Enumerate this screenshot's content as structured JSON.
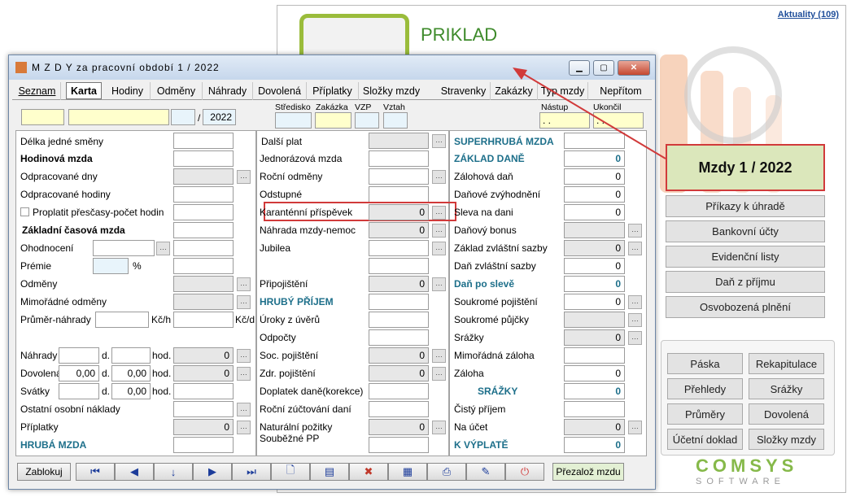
{
  "bg": {
    "news": "Aktuality (109)",
    "app_name": "PRIKLAD",
    "mzdy_button": "Mzdy  1 / 2022",
    "menu": [
      "Příkazy k úhradě",
      "Bankovní účty",
      "Evidenční listy",
      "Daň z příjmu",
      "Osvobozená plnění"
    ],
    "grid": [
      "Páska",
      "Rekapitulace",
      "Přehledy",
      "Srážky",
      "Průměry",
      "Dovolená",
      "Účetní doklad",
      "Složky mzdy"
    ],
    "brand1": "COMSYS",
    "brand2": "SOFTWARE"
  },
  "win": {
    "title": "M Z D Y  za pracovní období  1 / 2022",
    "btn_min": "▁",
    "btn_max": "▢",
    "btn_close": "✕",
    "tabs": [
      "Seznam",
      "Karta",
      "Hodiny",
      "Odměny",
      "Náhrady",
      "Dovolená",
      "Příplatky",
      "Složky mzdy",
      "Stravenky",
      "Zakázky",
      "Typ mzdy",
      "Nepřítom"
    ],
    "hdr": {
      "year": "2022",
      "slash": "/",
      "stredisko": "Středisko",
      "zakazka": "Zakázka",
      "vzp": "VZP",
      "vztah": "Vztah",
      "nastup": "Nástup",
      "ukoncil": "Ukončil",
      "nastup_val": ". .",
      "ukoncil_val": ". ."
    },
    "left": {
      "delka": "Délka jedné směny",
      "hodinova": "Hodinová mzda",
      "odpr_dny": "Odpracované dny",
      "odpr_hod": "Odpracované hodiny",
      "proplatit": "Proplatit přesčasy-počet hodin",
      "zakl": "Základní časová mzda",
      "ohodnoceni": "Ohodnocení",
      "premie": "Prémie",
      "pct": "%",
      "odmeny": "Odměny",
      "mimor": "Mimořádné odměny",
      "prumer": "Průměr-náhrady",
      "kch": "Kč/h",
      "kcd": "Kč/d",
      "nahrady": "Náhrady",
      "dovolena": "Dovolená",
      "svatky": "Svátky",
      "d": "d.",
      "hod": "hod.",
      "dov_d": "0,00",
      "dov_h": "0,00",
      "sv_h": "0,00",
      "nah_v": "0",
      "dov_v": "0",
      "ostatni": "Ostatní osobní náklady",
      "priplatky": "Příplatky",
      "pripl_v": "0",
      "hruba": "HRUBÁ MZDA"
    },
    "mid": {
      "dalsi": "Další plat",
      "jednoraz": "Jednorázová mzda",
      "rocni": "Roční odměny",
      "odstupne": "Odstupné",
      "karant": "Karanténní příspěvek",
      "karant_v": "0",
      "nahrada": "Náhrada mzdy-nemoc",
      "nahrada_v": "0",
      "jubilea": "Jubilea",
      "pripoj": "Připojištění",
      "pripoj_v": "0",
      "hruby": "HRUBÝ PŘÍJEM",
      "uroky": "Úroky z úvěrů",
      "odpocty": "Odpočty",
      "soc": "Soc. pojištění",
      "soc_v": "0",
      "zdr": "Zdr. pojištění",
      "zdr_v": "0",
      "doplatek": "Doplatek daně(korekce)",
      "rocni_zuct": "Roční zúčtování daní",
      "natur": "Naturální požitky",
      "natur_v": "0",
      "soubezne": "Souběžné PP"
    },
    "right": {
      "super": "SUPERHRUBÁ MZDA",
      "zaklad": "ZÁKLAD DANĚ",
      "zaklad_v": "0",
      "zaloh": "Zálohová daň",
      "zaloh_v": "0",
      "danzv": "Daňové zvýhodnění",
      "danzv_v": "0",
      "sleva": "Sleva na dani",
      "sleva_v": "0",
      "bonus": "Daňový bonus",
      "zakl_zvl": "Základ zvláštní sazby",
      "zakl_zvl_v": "0",
      "dan_zvl": "Daň zvláštní sazby",
      "dan_zvl_v": "0",
      "dan_po": "Daň po slevě",
      "dan_po_v": "0",
      "souk_poj": "Soukromé pojištění",
      "souk_poj_v": "0",
      "souk_puj": "Soukromé půjčky",
      "srazky": "Srážky",
      "srazky_v": "0",
      "mim_zal": "Mimořádná záloha",
      "zaloha": "Záloha",
      "zaloha_v": "0",
      "srazky_h": "SRÁŽKY",
      "srazky_h_v": "0",
      "cisty": "Čistý příjem",
      "na_ucet": "Na účet",
      "na_ucet_v": "0",
      "k_vyplate": "K VÝPLATĚ",
      "k_vyplate_v": "0"
    },
    "bottom": {
      "zablokuj": "Zablokuj",
      "prezaloz": "Přezalož mzdu",
      "icons": [
        "⏮",
        "◀",
        "↓",
        "▶",
        "⏭",
        "🗋",
        "▤",
        "✖",
        "▦",
        "⎙",
        "✎",
        "⏻"
      ]
    }
  },
  "colors": {
    "accent": "#d13a3a",
    "teal": "#1d6f8a",
    "green": "#86b94a"
  }
}
